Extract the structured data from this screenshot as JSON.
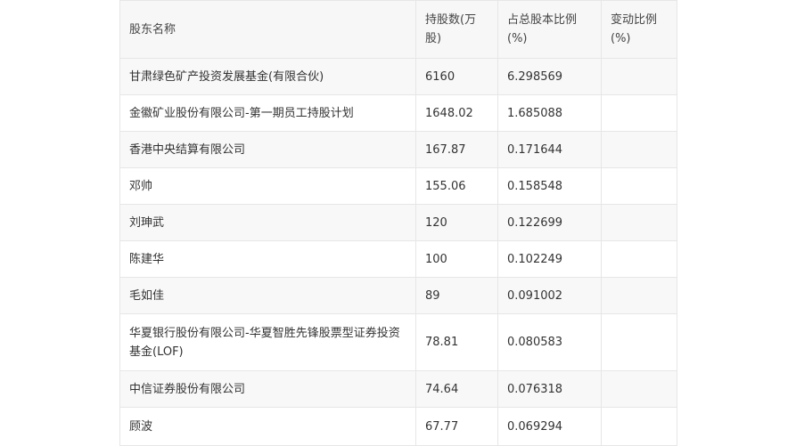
{
  "table": {
    "headers": [
      "股东名称",
      "持股数(万股)",
      "占总股本比例(%)",
      "变动比例(%)"
    ],
    "rows": [
      {
        "name": "甘肃绿色矿产投资发展基金(有限合伙)",
        "shares": "6160",
        "ratio": "6.298569",
        "change": ""
      },
      {
        "name": "金徽矿业股份有限公司-第一期员工持股计划",
        "shares": "1648.02",
        "ratio": "1.685088",
        "change": ""
      },
      {
        "name": "香港中央结算有限公司",
        "shares": "167.87",
        "ratio": "0.171644",
        "change": ""
      },
      {
        "name": "邓帅",
        "shares": "155.06",
        "ratio": "0.158548",
        "change": ""
      },
      {
        "name": "刘珅武",
        "shares": "120",
        "ratio": "0.122699",
        "change": ""
      },
      {
        "name": "陈建华",
        "shares": "100",
        "ratio": "0.102249",
        "change": ""
      },
      {
        "name": "毛如佳",
        "shares": "89",
        "ratio": "0.091002",
        "change": ""
      },
      {
        "name": "华夏银行股份有限公司-华夏智胜先锋股票型证券投资基金(LOF)",
        "shares": "78.81",
        "ratio": "0.080583",
        "change": ""
      },
      {
        "name": "中信证券股份有限公司",
        "shares": "74.64",
        "ratio": "0.076318",
        "change": ""
      },
      {
        "name": "顾波",
        "shares": "67.77",
        "ratio": "0.069294",
        "change": ""
      }
    ]
  }
}
